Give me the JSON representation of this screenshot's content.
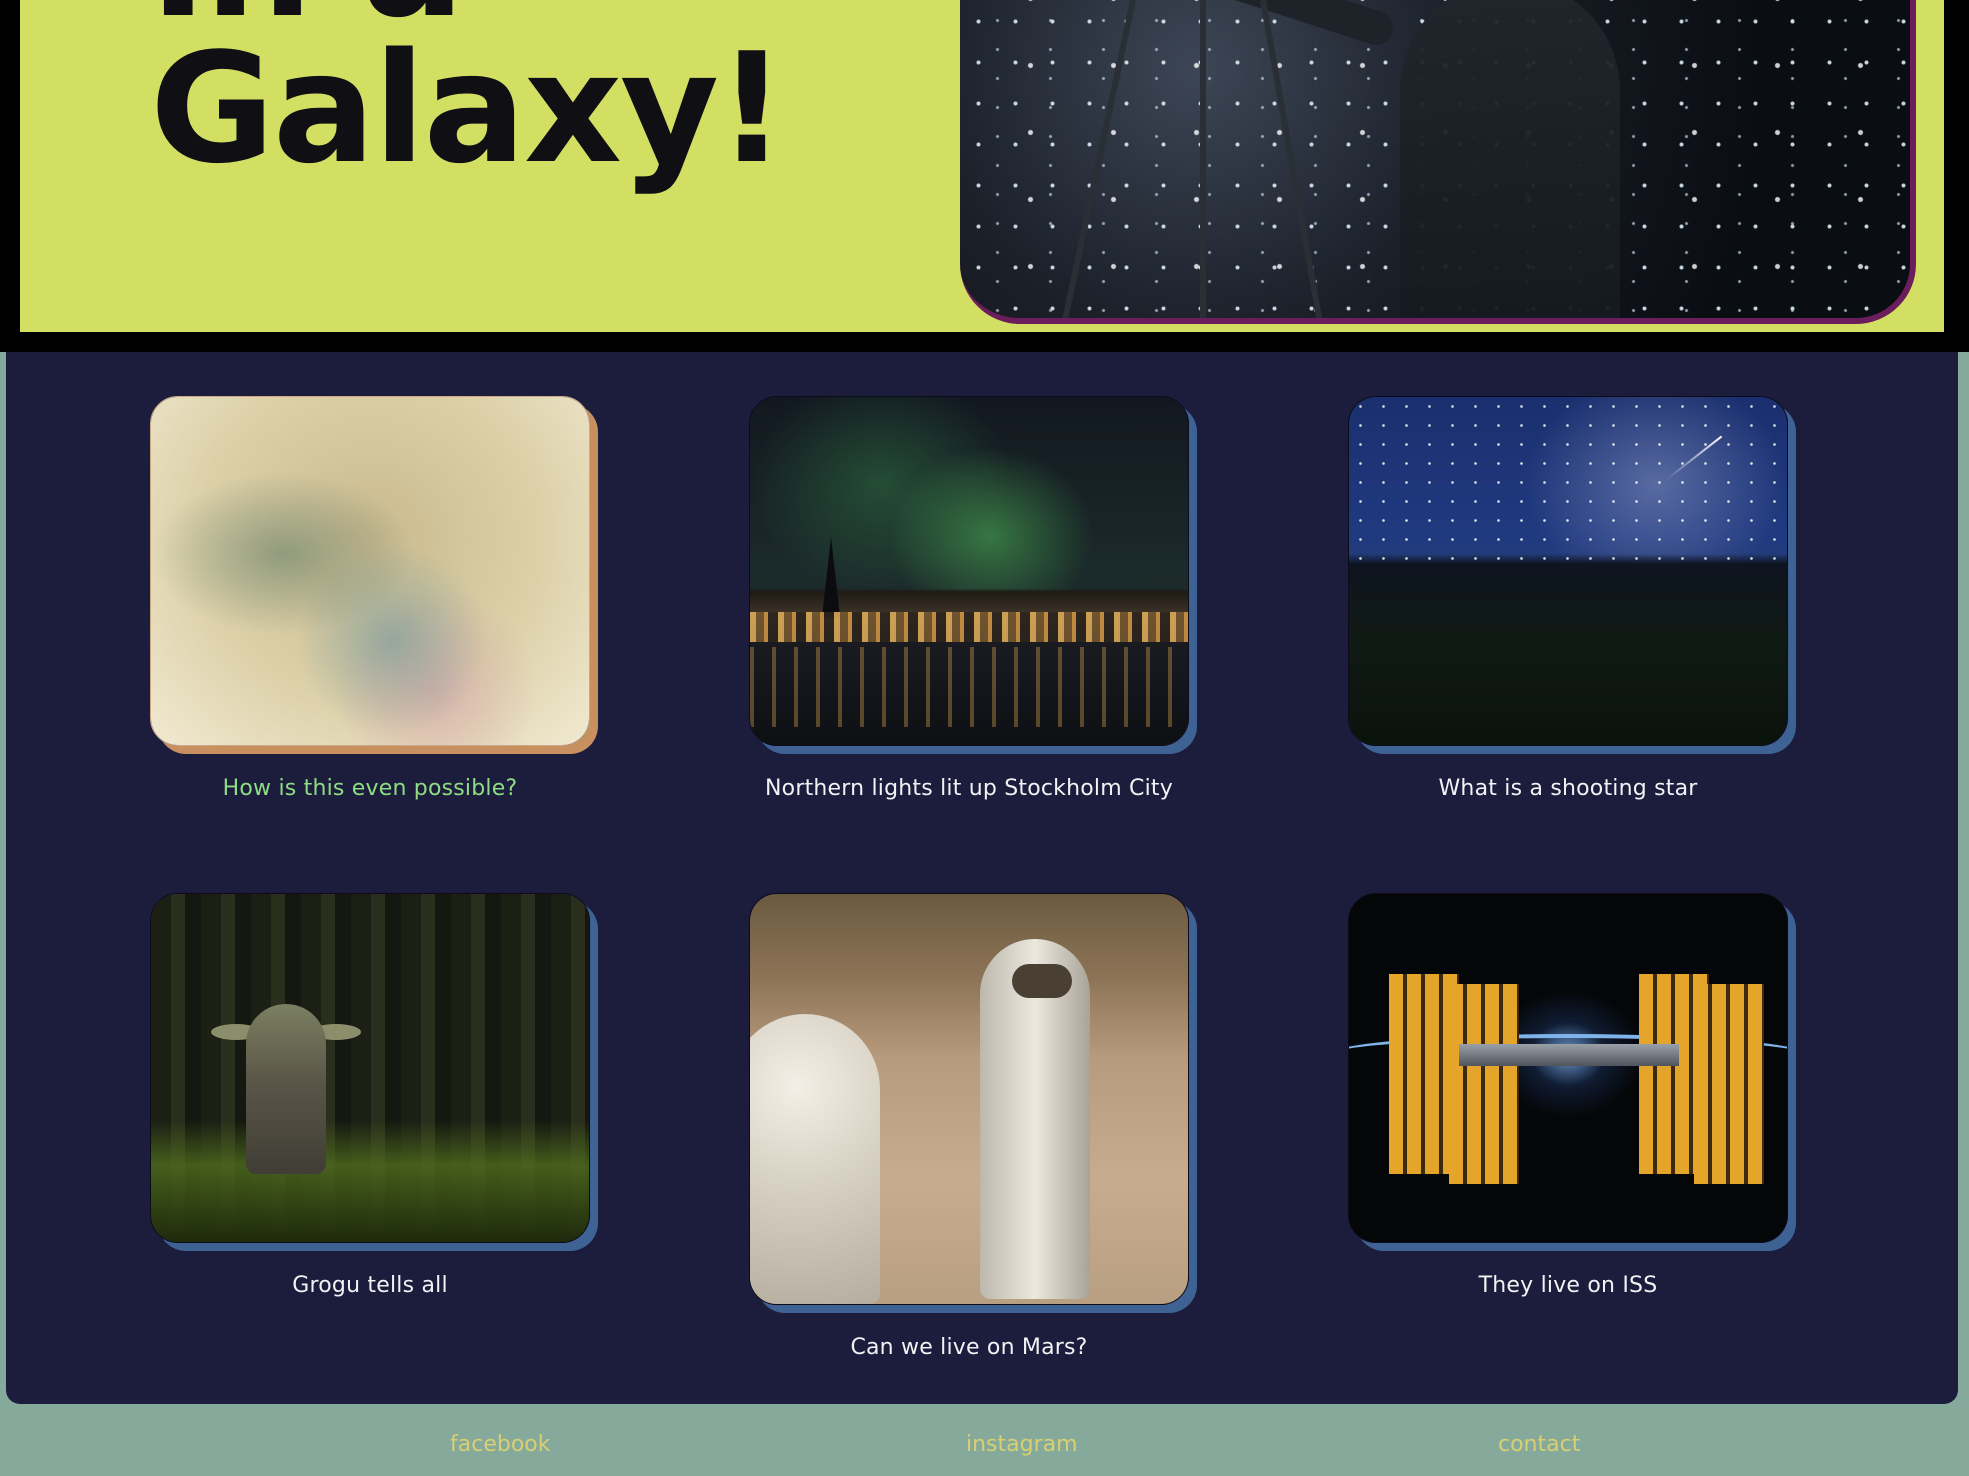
{
  "hero": {
    "title_line1": "In a",
    "title_line2": "Galaxy!"
  },
  "gallery": {
    "cards": [
      {
        "caption": "How is this even possible?",
        "image": "nebula"
      },
      {
        "caption": "Northern lights lit up Stockholm City",
        "image": "stockholm"
      },
      {
        "caption": "What is a shooting star",
        "image": "shooting-star"
      },
      {
        "caption": "Grogu tells all",
        "image": "grogu"
      },
      {
        "caption": "Can we live on Mars?",
        "image": "mars-astronauts"
      },
      {
        "caption": "They live on ISS",
        "image": "iss"
      }
    ]
  },
  "footer": {
    "links": [
      "facebook",
      "instagram",
      "contact"
    ]
  },
  "colors": {
    "hero_bg": "#d3df63",
    "panel_bg": "#1c1c3d",
    "page_bg": "#85a99a",
    "highlight_caption": "#8fdd83",
    "footer_link": "#d9cf73",
    "card_shadow": "#3f6294"
  }
}
